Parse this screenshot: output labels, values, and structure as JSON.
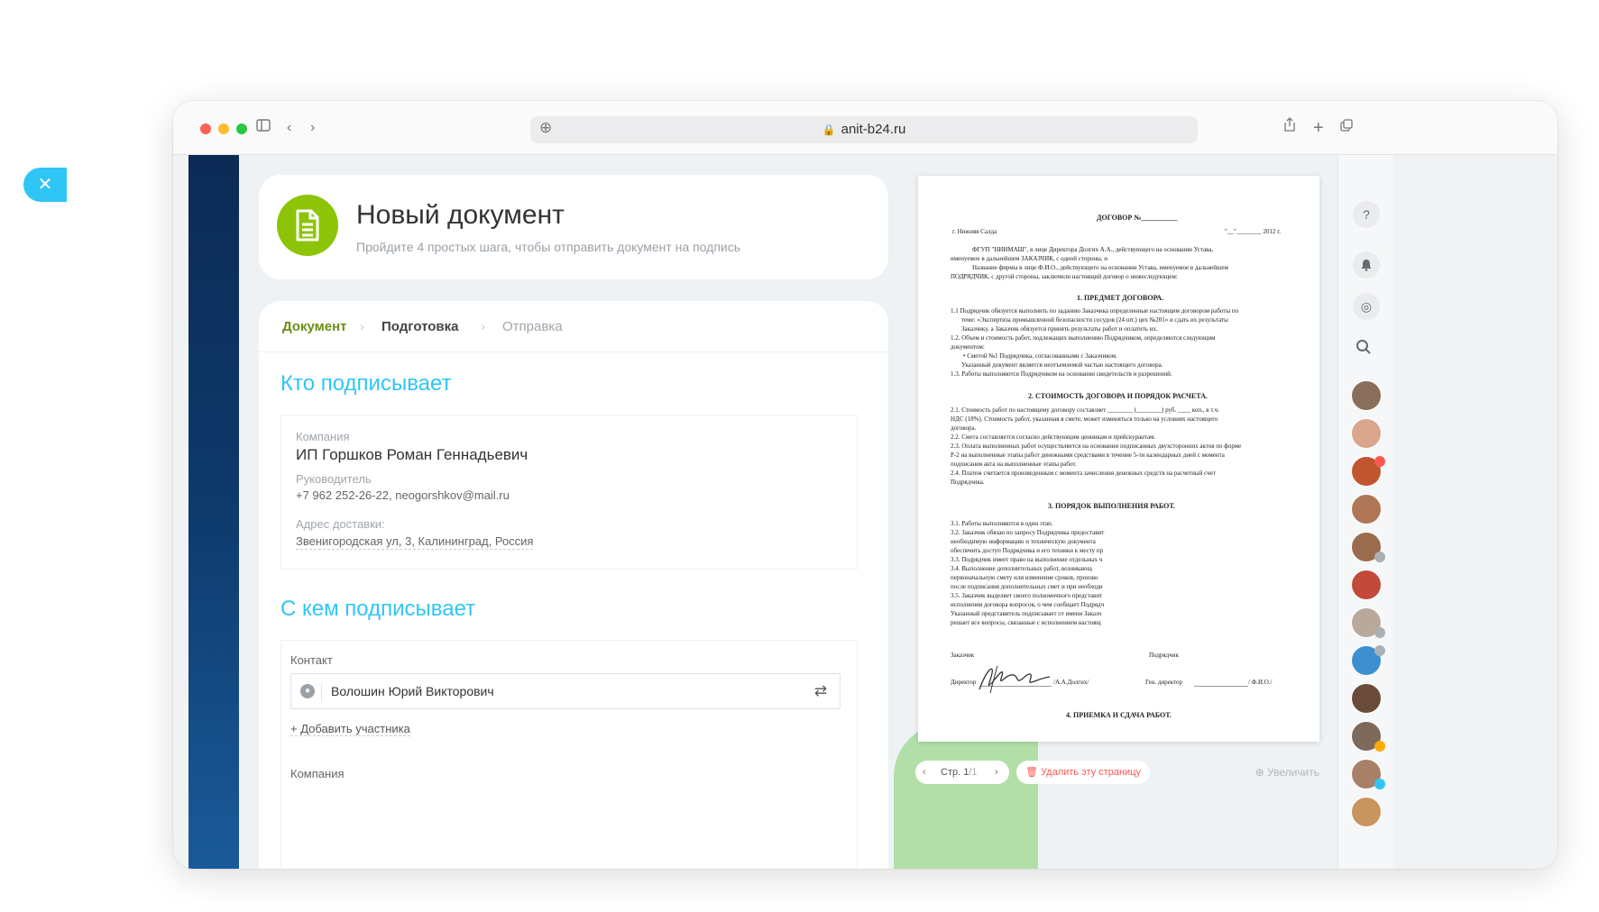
{
  "browser": {
    "url": "anit-b24.ru"
  },
  "header": {
    "title": "Новый документ",
    "subtitle": "Пройдите 4 простых шага, чтобы отправить документ на подпись"
  },
  "steps": [
    {
      "label": "Документ"
    },
    {
      "label": "Подготовка"
    },
    {
      "label": "Отправка"
    }
  ],
  "who_signs": {
    "title": "Кто подписывает",
    "company_label": "Компания",
    "company_value": "ИП Горшков Роман Геннадьевич",
    "head_label": "Руководитель",
    "head_value": "+7 962 252-26-22, neogorshkov@mail.ru",
    "address_label": "Адрес доставки:",
    "address_value": "Звенигородская ул, 3, Калининград, Россия"
  },
  "with_whom": {
    "title": "С кем подписывает",
    "contact_label": "Контакт",
    "contact_value": "Волошин Юрий Викторович",
    "add_member": "+ Добавить участника",
    "company_label": "Компания"
  },
  "contract": {
    "title": "ДОГОВОР №__________",
    "city": "г. Нижняя Салда",
    "date": "\"__\"________ 2012 г.",
    "intro": [
      "ФГУП \"НИИМАШ\", в лице Директора Долгих А.А., действующего на основании Устава,",
      "именуемое в дальнейшем ЗАКАЗЧИК, с одной стороны, и",
      "Название фирмы в лице Ф.И.О., действующего на основании Устава, именуемое в дальнейшем",
      "ПОДРЯДЧИК, с другой стороны, заключили настоящий договор о нижеследующем:"
    ],
    "s1_title": "1. ПРЕДМЕТ ДОГОВОРА.",
    "s1": [
      "1.1 Подрядчик обязуется выполнить по заданию Заказчика определенные настоящим договором работы по",
      "теме: «Экспертиза промышленной безопасности сосудов (24 шт.) цех №201» и сдать их результаты",
      "Заказчику, а Заказчик обязуется принять результаты работ и оплатить их.",
      "1.2. Объем и стоимость работ, подлежащих выполнению Подрядчиком, определяются следующим",
      "документом:",
      "• Сметой №1 Подрядчика, согласованными с Заказчиком.",
      "Указанный документ является неотъемлемой частью настоящего договора.",
      "1.3. Работы выполняются Подрядчиком на основании свидетельств и разрешений."
    ],
    "s2_title": "2. СТОИМОСТЬ ДОГОВОРА И ПОРЯДОК РАСЧЕТА.",
    "s2": [
      "2.1. Стоимость работ по настоящему договору составляет ________ (________) руб. ____ коп., в т.ч.",
      "НДС (18%). Стоимость работ, указанная в смете, может изменяться только на условиях настоящего",
      "договора.",
      "2.2. Смета составляется согласно действующим ценникам и прейскурантам.",
      "2.3. Оплата выполненных работ осуществляется на основании подписанных двухсторонних актов по форме",
      "Р-2 на выполненные этапы работ денежными средствами в течение 5-ти календарных дней с момента",
      "подписания акта на выполненные этапы работ.",
      "2.4. Платеж считается произведенным с момента зачисления денежных средств на расчетный счет",
      "Подрядчика."
    ],
    "s3_title": "3. ПОРЯДОК ВЫПОЛНЕНИЯ РАБОТ.",
    "s3": [
      "3.1. Работы выполняются в один этап.",
      "3.2. Заказчик обязан по запросу Подрядчика предоставит",
      "необходимую информацию и техническую документа",
      "обеспечить доступ Подрядчика и его техники к месту пр",
      "3.3. Подрядчик имеет право на выполнение отдельных ч",
      "3.4. Выполнение дополнительных работ, возникающ",
      "первоначальную смету или изменение сроков, произво",
      "после подписания дополнительных смет и при необходи",
      "3.5. Заказчик выделяет своего полномочного представит",
      "исполнения договора вопросов, о чем сообщает Подрядч",
      "Указанный представитель подписывает от имени Заказч",
      "решает все вопросы, связанные с исполнением настоящ"
    ],
    "customer_label": "Заказчик",
    "contractor_label": "Подрядчик",
    "director_label": "Директор",
    "director_sig": "/А.А.Долгих/",
    "gen_director_label": "Ген. директор",
    "gen_director_sig": "/ Ф.И.О./",
    "s4_title": "4. ПРИЕМКА И СДАЧА РАБОТ."
  },
  "pager": {
    "page_label": "Стр. 1",
    "total": "/1"
  },
  "preview_actions": {
    "delete_page": "Удалить эту страницу",
    "zoom": "Увеличить"
  },
  "colors": {
    "accent_blue": "#2fc6f6",
    "accent_green": "#8dc407",
    "step_active": "#6b8f14",
    "danger": "#ff5752"
  }
}
